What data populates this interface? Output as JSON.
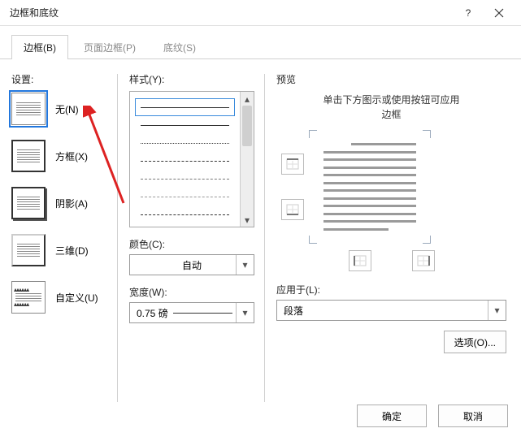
{
  "window": {
    "title": "边框和底纹"
  },
  "tabs": {
    "border": "边框(B)",
    "page_border": "页面边框(P)",
    "shading": "底纹(S)"
  },
  "settings": {
    "label": "设置:",
    "none": "无(N)",
    "box": "方框(X)",
    "shadow": "阴影(A)",
    "three_d": "三维(D)",
    "custom": "自定义(U)"
  },
  "style": {
    "label": "样式(Y):",
    "color_label": "颜色(C):",
    "color_value": "自动",
    "width_label": "宽度(W):",
    "width_value": "0.75 磅"
  },
  "preview": {
    "label": "预览",
    "hint_line1": "单击下方图示或使用按钮可应用",
    "hint_line2": "边框",
    "apply_label": "应用于(L):",
    "apply_value": "段落",
    "options": "选项(O)..."
  },
  "footer": {
    "ok": "确定",
    "cancel": "取消"
  }
}
